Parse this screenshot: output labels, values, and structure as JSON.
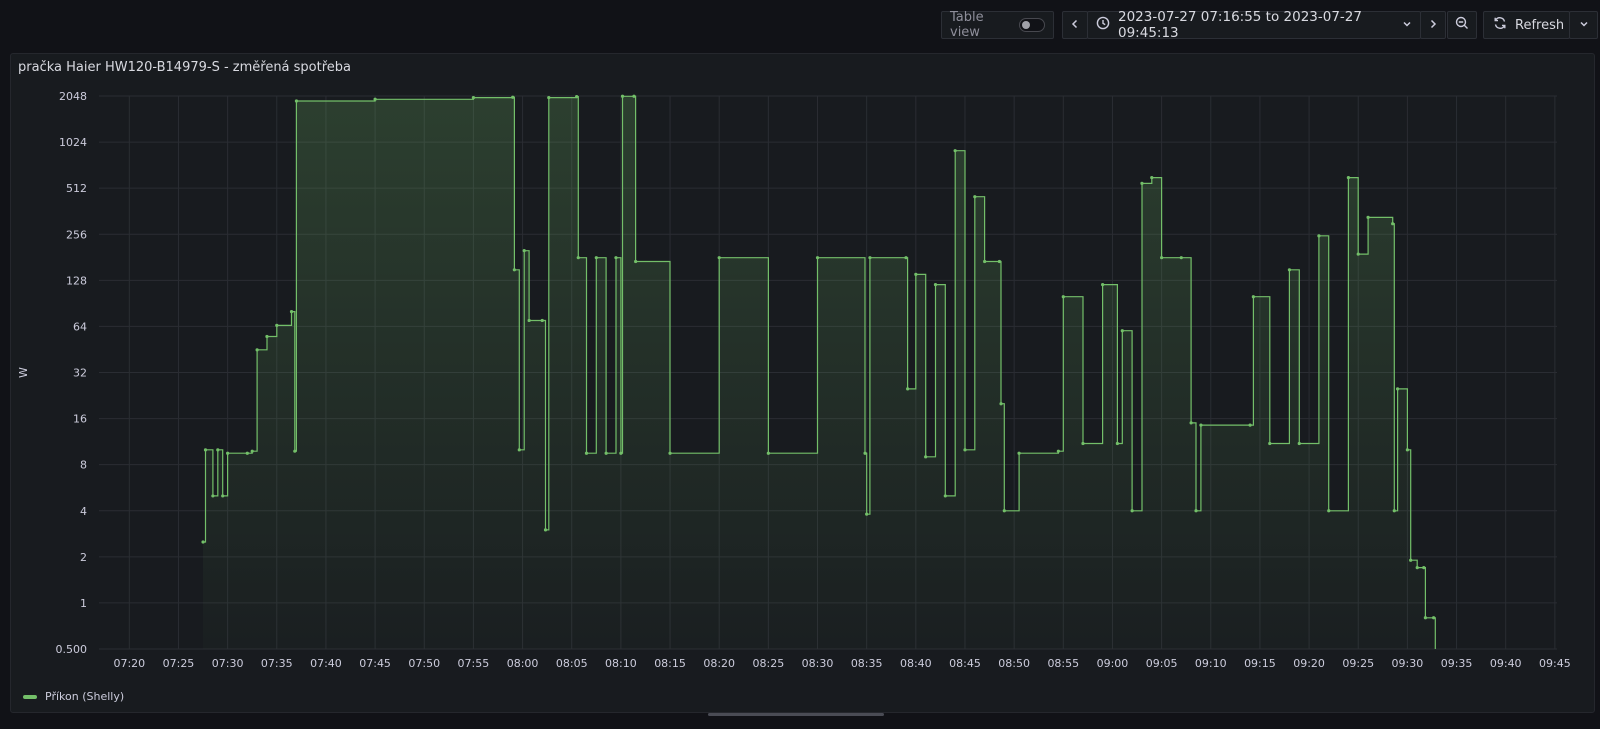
{
  "toolbar": {
    "table_view_label": "Table view",
    "time_range": "2023-07-27 07:16:55 to 2023-07-27 09:45:13",
    "refresh_label": "Refresh"
  },
  "panel": {
    "title": "pračka Haier HW120-B14979-S - změřená spotřeba"
  },
  "colors": {
    "series": "#73bf69",
    "background": "#181b1f",
    "grid": "#2a2d33"
  },
  "chart_data": {
    "type": "line",
    "title": "pračka Haier HW120-B14979-S - změřená spotřeba",
    "ylabel": "W",
    "xlabel": "",
    "y_scale": "log2",
    "ylim": [
      0.5,
      2048
    ],
    "y_ticks": [
      "0.500",
      "1",
      "2",
      "4",
      "8",
      "16",
      "32",
      "64",
      "128",
      "256",
      "512",
      "1024",
      "2048"
    ],
    "x_ticks": [
      "07:20",
      "07:25",
      "07:30",
      "07:35",
      "07:40",
      "07:45",
      "07:50",
      "07:55",
      "08:00",
      "08:05",
      "08:10",
      "08:15",
      "08:20",
      "08:25",
      "08:30",
      "08:35",
      "08:40",
      "08:45",
      "08:50",
      "08:55",
      "09:00",
      "09:05",
      "09:10",
      "09:15",
      "09:20",
      "09:25",
      "09:30",
      "09:35",
      "09:40",
      "09:45"
    ],
    "grid": true,
    "legend_position": "bottom-left",
    "series": [
      {
        "name": "Příkon (Shelly)",
        "points": [
          [
            "07:27:30",
            2.5
          ],
          [
            "07:27:45",
            10
          ],
          [
            "07:28:30",
            5
          ],
          [
            "07:29:00",
            10
          ],
          [
            "07:29:30",
            5
          ],
          [
            "07:30:00",
            9.5
          ],
          [
            "07:32:00",
            9.5
          ],
          [
            "07:32:30",
            9.8
          ],
          [
            "07:33:00",
            45
          ],
          [
            "07:34:00",
            55
          ],
          [
            "07:35:00",
            65
          ],
          [
            "07:36:30",
            80
          ],
          [
            "07:36:50",
            9.8
          ],
          [
            "07:37:00",
            1900
          ],
          [
            "07:45:00",
            1950
          ],
          [
            "07:55:00",
            2000
          ],
          [
            "07:59:00",
            2010
          ],
          [
            "07:59:10",
            150
          ],
          [
            "07:59:40",
            10
          ],
          [
            "08:00:10",
            200
          ],
          [
            "08:00:40",
            70
          ],
          [
            "08:02:00",
            70
          ],
          [
            "08:02:20",
            3
          ],
          [
            "08:02:40",
            2000
          ],
          [
            "08:05:30",
            2030
          ],
          [
            "08:05:40",
            180
          ],
          [
            "08:06:30",
            9.5
          ],
          [
            "08:07:30",
            180
          ],
          [
            "08:08:30",
            9.5
          ],
          [
            "08:09:30",
            180
          ],
          [
            "08:10:00",
            9.5
          ],
          [
            "08:10:10",
            2040
          ],
          [
            "08:11:20",
            2040
          ],
          [
            "08:11:30",
            170
          ],
          [
            "08:15:00",
            9.5
          ],
          [
            "08:20:00",
            180
          ],
          [
            "08:25:00",
            9.5
          ],
          [
            "08:30:00",
            180
          ],
          [
            "08:34:50",
            9.5
          ],
          [
            "08:35:00",
            3.8
          ],
          [
            "08:35:20",
            180
          ],
          [
            "08:39:00",
            180
          ],
          [
            "08:39:10",
            25
          ],
          [
            "08:40:00",
            140
          ],
          [
            "08:41:00",
            9
          ],
          [
            "08:42:00",
            120
          ],
          [
            "08:43:00",
            5
          ],
          [
            "08:44:00",
            900
          ],
          [
            "08:45:00",
            10
          ],
          [
            "08:46:00",
            450
          ],
          [
            "08:47:00",
            170
          ],
          [
            "08:48:30",
            170
          ],
          [
            "08:48:40",
            20
          ],
          [
            "08:49:00",
            4
          ],
          [
            "08:50:30",
            9.5
          ],
          [
            "08:54:30",
            9.8
          ],
          [
            "08:55:00",
            100
          ],
          [
            "08:57:00",
            11
          ],
          [
            "08:59:00",
            120
          ],
          [
            "09:00:30",
            11
          ],
          [
            "09:01:00",
            60
          ],
          [
            "09:02:00",
            4
          ],
          [
            "09:03:00",
            550
          ],
          [
            "09:04:00",
            600
          ],
          [
            "09:05:00",
            180
          ],
          [
            "09:07:00",
            180
          ],
          [
            "09:08:00",
            15
          ],
          [
            "09:08:30",
            4
          ],
          [
            "09:09:00",
            14.5
          ],
          [
            "09:14:00",
            14.5
          ],
          [
            "09:14:20",
            100
          ],
          [
            "09:16:00",
            11
          ],
          [
            "09:18:00",
            150
          ],
          [
            "09:19:00",
            11
          ],
          [
            "09:21:00",
            250
          ],
          [
            "09:22:00",
            4
          ],
          [
            "09:24:00",
            600
          ],
          [
            "09:25:00",
            190
          ],
          [
            "09:26:00",
            330
          ],
          [
            "09:28:30",
            300
          ],
          [
            "09:28:40",
            4
          ],
          [
            "09:29:00",
            25
          ],
          [
            "09:30:00",
            10
          ],
          [
            "09:30:20",
            1.9
          ],
          [
            "09:31:00",
            1.7
          ],
          [
            "09:31:40",
            1.7
          ],
          [
            "09:31:50",
            0.8
          ],
          [
            "09:32:40",
            0.8
          ],
          [
            "09:32:50",
            0.45
          ]
        ]
      }
    ]
  }
}
